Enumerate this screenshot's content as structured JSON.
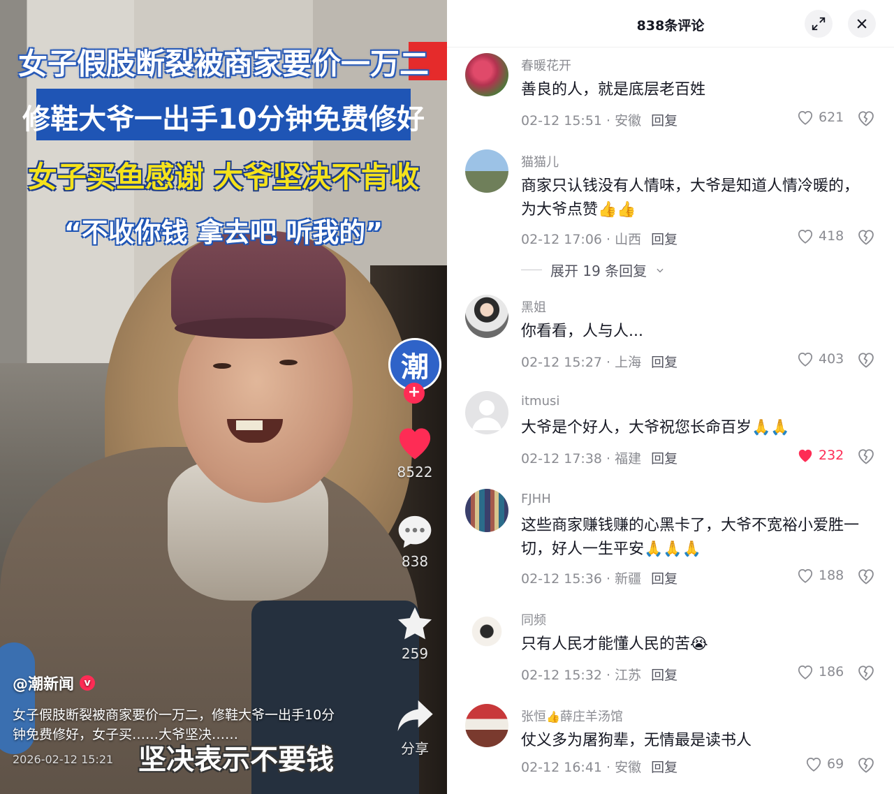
{
  "video": {
    "overlay_line1": "女子假肢断裂被商家要价一万二",
    "overlay_line2": "修鞋大爷一出手10分钟免费修好",
    "overlay_line3": "女子买鱼感谢 大爷坚决不肯收",
    "overlay_line4": "“不收你钱 拿去吧 听我的”",
    "channel_avatar_text": "潮",
    "follow_symbol": "+",
    "like_count": "8522",
    "comment_count": "838",
    "favorite_count": "259",
    "share_label": "分享",
    "author": "@潮新闻",
    "verified_mark": "v",
    "description": "女子假肢断裂被商家要价一万二，修鞋大爷一出手10分钟免费修好，女子买……大爷坚决……",
    "timestamp": "2026-02-12 15:21",
    "subtitle": "坚决表示不要钱",
    "colors": {
      "brand_blue": "#1f55b5",
      "like_red": "#fe2c55",
      "title_yellow": "#f5e21b"
    }
  },
  "panel": {
    "title": "838条评论",
    "expand_icon": "expand-icon",
    "close_icon": "close-icon"
  },
  "comments": [
    {
      "name": "春暖花开",
      "text": "善良的人，就是底层老百姓",
      "meta": "02-12 15:51 · 安徽",
      "reply": "回复",
      "likes": "621",
      "liked": false,
      "avatar": "flowers"
    },
    {
      "name": "猫猫儿",
      "text": "商家只认钱没有人情味，大爷是知道人情冷暖的，为大爷点赞👍👍",
      "meta": "02-12 17:06 · 山西",
      "reply": "回复",
      "likes": "418",
      "liked": false,
      "avatar": "tower"
    },
    {
      "name": "黑姐",
      "text": "你看看，人与人...",
      "meta": "02-12 15:27 · 上海",
      "reply": "回复",
      "likes": "403",
      "liked": false,
      "avatar": "woman"
    },
    {
      "name": "itmusi",
      "text": "大爷是个好人，大爷祝您长命百岁🙏🙏",
      "meta": "02-12 17:38 · 福建",
      "reply": "回复",
      "likes": "232",
      "liked": true,
      "avatar": "default"
    },
    {
      "name": "FJHH",
      "text": "这些商家赚钱赚的心黑卡了，大爷不宽裕小爱胜一切，好人一生平安🙏🙏🙏",
      "meta": "02-12 15:36 · 新疆",
      "reply": "回复",
      "likes": "188",
      "liked": false,
      "avatar": "collage"
    },
    {
      "name": "同频",
      "text": "只有人民才能懂人民的苦😭",
      "meta": "02-12 15:32 · 江苏",
      "reply": "回复",
      "likes": "186",
      "liked": false,
      "avatar": "cartoon"
    },
    {
      "name": "张恒",
      "name_badge": "👍",
      "name_suffix": "薛庄羊汤馆",
      "text": "仗义多为屠狗辈，无情最是读书人",
      "meta": "02-12 16:41 · 安徽",
      "reply": "回复",
      "likes": "69",
      "liked": false,
      "avatar": "shop"
    }
  ],
  "expand_replies": "展开 19 条回复"
}
